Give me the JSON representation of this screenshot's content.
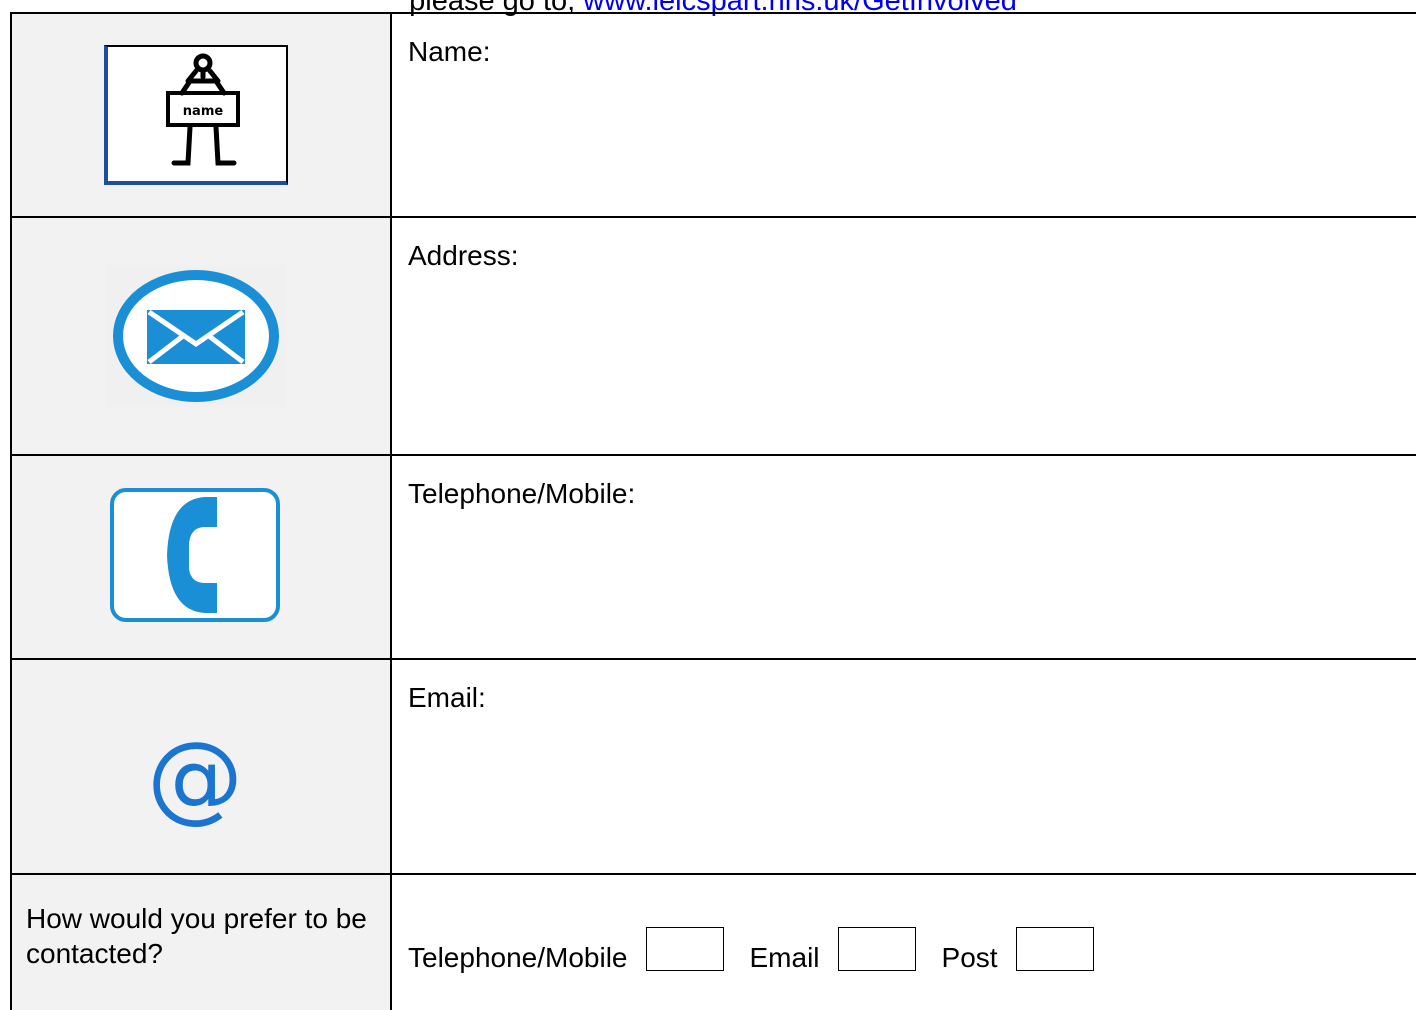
{
  "header": {
    "prefix": "please go to, ",
    "link_text": "www.leicspart.nhs.uk/GetInvolved"
  },
  "fields": {
    "name_label": "Name:",
    "address_label": "Address:",
    "telephone_label": "Telephone/Mobile:",
    "email_label": "Email:"
  },
  "icons": {
    "name_sign_text": "name",
    "at_symbol": "@"
  },
  "preference": {
    "question": "How would you prefer to be contacted?",
    "options": [
      "Telephone/Mobile",
      "Email",
      "Post"
    ]
  },
  "colors": {
    "icon_blue": "#1b8fd6",
    "icon_cell_bg": "#f2f2f2",
    "link": "#0000ee"
  }
}
